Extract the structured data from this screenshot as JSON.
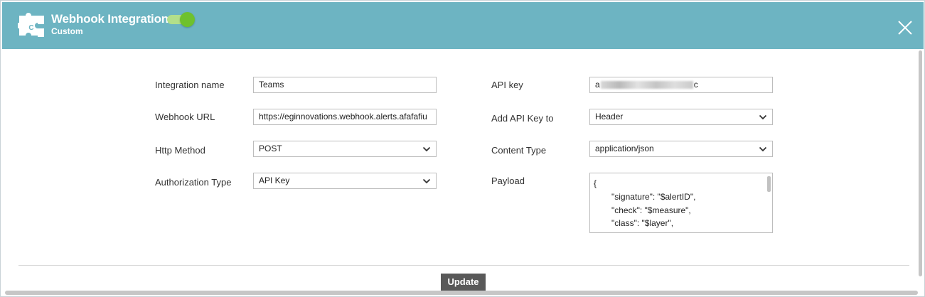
{
  "header": {
    "title": "Webhook Integration",
    "subtitle": "Custom",
    "logo_icon": "puzzle-icon",
    "logo_letter": "C",
    "enabled": true,
    "close_icon": "close-icon",
    "color": "#6db4c2"
  },
  "form": {
    "integration_name": {
      "label": "Integration name",
      "value": "Teams"
    },
    "webhook_url": {
      "label": "Webhook URL",
      "value": "https://eginnovations.webhook.alerts.afafafiu"
    },
    "http_method": {
      "label": "Http Method",
      "value": "POST"
    },
    "authorization_type": {
      "label": "Authorization Type",
      "value": "API Key"
    },
    "api_key": {
      "label": "API key",
      "value_start": "a",
      "value_end": "c"
    },
    "add_api_key_to": {
      "label": "Add API Key to",
      "value": "Header"
    },
    "content_type": {
      "label": "Content Type",
      "value": "application/json"
    },
    "payload": {
      "label": "Payload",
      "lines": [
        "{",
        "\"signature\": \"$alertID\",",
        "\"check\": \"$measure\",",
        "\"class\": \"$layer\","
      ]
    }
  },
  "footer": {
    "update_label": "Update",
    "update_color": "#595959"
  }
}
